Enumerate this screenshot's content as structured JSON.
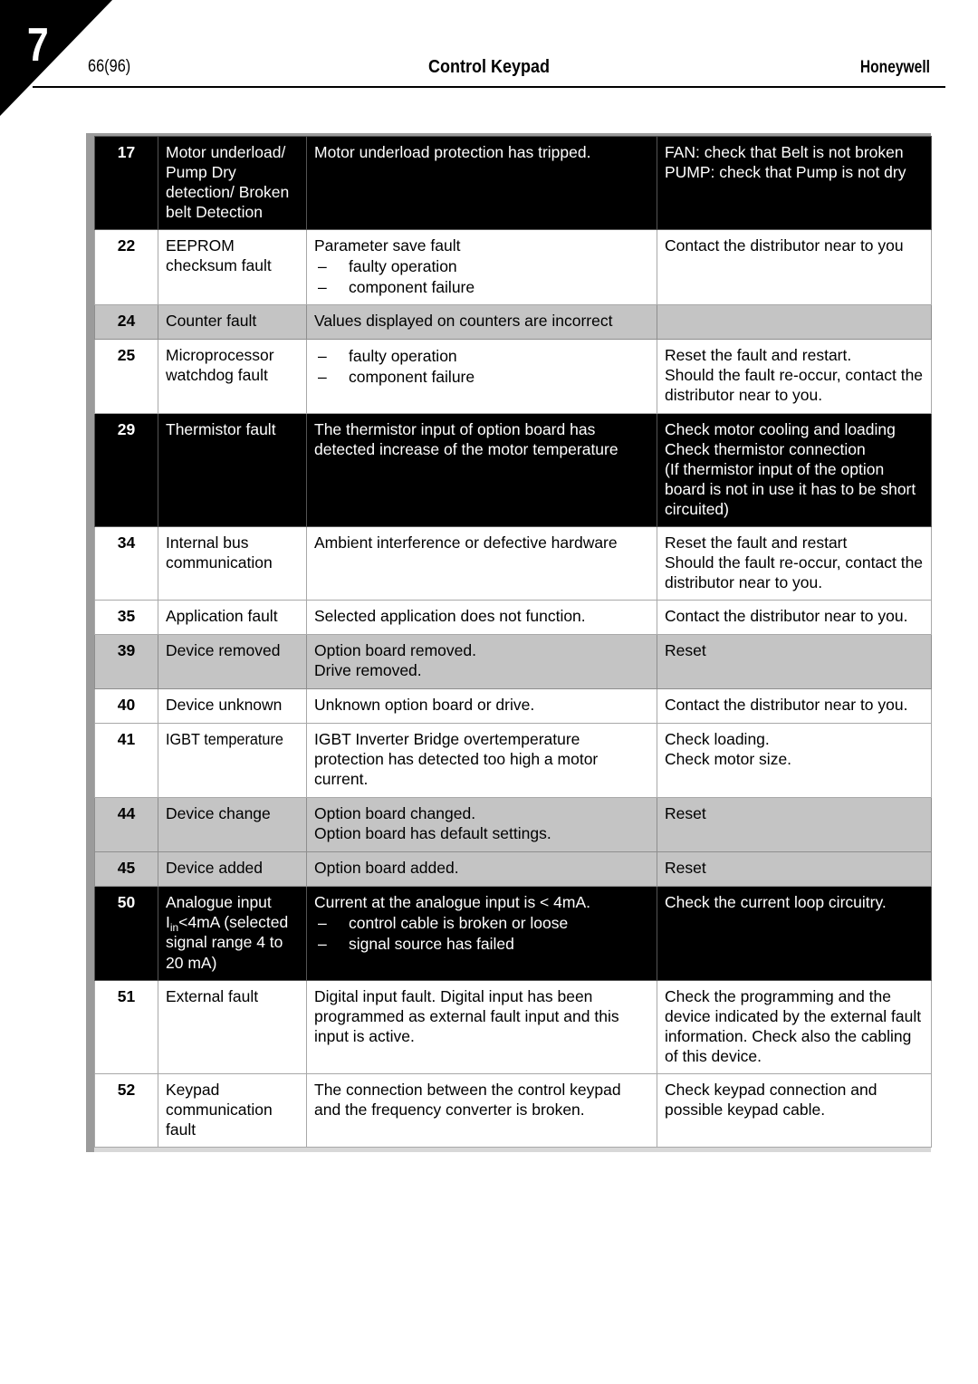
{
  "header": {
    "chapter": "7",
    "page_number": "66(96)",
    "title": "Control Keypad",
    "brand": "Honeywell"
  },
  "colors": {
    "dark_row_bg": "#000000",
    "dark_row_text": "#ffffff",
    "gray_row_bg": "#c4c4c4",
    "light_row_bg": "#ffffff",
    "frame": "#9b9b9b",
    "rule": "#000000"
  },
  "table": {
    "rows": [
      {
        "shade": "dark",
        "code": "17",
        "name": "Motor underload/ Pump Dry detection/ Broken belt Detection",
        "cause_lead": "Motor underload protection has tripped.",
        "cause_items": [],
        "fix": "FAN: check that Belt is not broken\nPUMP: check that Pump is not dry"
      },
      {
        "shade": "light",
        "code": "22",
        "name": "EEPROM checksum fault",
        "cause_lead": "Parameter save fault",
        "cause_items": [
          "faulty operation",
          "component failure"
        ],
        "fix": "Contact the distributor near to you"
      },
      {
        "shade": "gray",
        "code": "24",
        "name": "Counter fault",
        "cause_lead": "Values displayed on counters are incorrect",
        "cause_items": [],
        "fix": ""
      },
      {
        "shade": "light",
        "code": "25",
        "name": "Microprocessor watchdog fault",
        "cause_lead": "",
        "cause_items": [
          "faulty operation",
          "component failure"
        ],
        "fix": "Reset the fault and restart.\nShould the fault re-occur, contact the distributor near to you."
      },
      {
        "shade": "dark",
        "code": "29",
        "name": "Thermistor fault",
        "cause_lead": "The thermistor input of option board has detected increase of the motor temperature",
        "cause_items": [],
        "fix": "Check motor cooling and loading\nCheck thermistor connection\n(If thermistor input of the option board is not in use it has to be short circuited)"
      },
      {
        "shade": "light",
        "code": "34",
        "name": "Internal bus communication",
        "cause_lead": "Ambient interference or defective hardware",
        "cause_items": [],
        "fix": "Reset the fault and restart\nShould the fault re-occur, contact the distributor near to you."
      },
      {
        "shade": "light",
        "code": "35",
        "name": "Application fault",
        "cause_lead": "Selected application does not function.",
        "cause_items": [],
        "fix": "Contact the distributor near to you."
      },
      {
        "shade": "gray",
        "code": "39",
        "name": "Device removed",
        "cause_lead": "Option board removed.\nDrive removed.",
        "cause_items": [],
        "fix": "Reset"
      },
      {
        "shade": "light",
        "code": "40",
        "name": "Device unknown",
        "cause_lead": "Unknown option board or drive.",
        "cause_items": [],
        "fix": "Contact the distributor near to you."
      },
      {
        "shade": "light",
        "code": "41",
        "name": "IGBT temperature",
        "cause_lead": "IGBT Inverter Bridge overtemperature protection has detected too high a motor current.",
        "cause_items": [],
        "fix": "Check loading.\nCheck motor size."
      },
      {
        "shade": "gray",
        "code": "44",
        "name": "Device change",
        "cause_lead": "Option board changed.\nOption board has default settings.",
        "cause_items": [],
        "fix": "Reset"
      },
      {
        "shade": "gray",
        "code": "45",
        "name": "Device added",
        "cause_lead": "Option board added.",
        "cause_items": [],
        "fix": "Reset"
      },
      {
        "shade": "dark",
        "code": "50",
        "name": "Analogue input Iin<4mA (selected signal range 4 to 20 mA)",
        "name_html": "Analogue input I<sub>in</sub>&lt;4mA (selected signal range 4 to 20 mA)",
        "cause_lead": "Current at the analogue input is < 4mA.",
        "cause_items": [
          "control cable is broken or loose",
          "signal source has failed"
        ],
        "fix": "Check the current loop circuitry."
      },
      {
        "shade": "light",
        "code": "51",
        "name": "External fault",
        "cause_lead": "Digital input fault. Digital input has been programmed as external fault input and this input is active.",
        "cause_items": [],
        "fix": "Check the programming and the device indicated by the external fault information. Check also the cabling of this device."
      },
      {
        "shade": "light",
        "code": "52",
        "name": "Keypad communication fault",
        "cause_lead": "The connection between the control keypad and the frequency converter is broken.",
        "cause_items": [],
        "fix": "Check keypad connection and possible keypad cable."
      }
    ]
  }
}
